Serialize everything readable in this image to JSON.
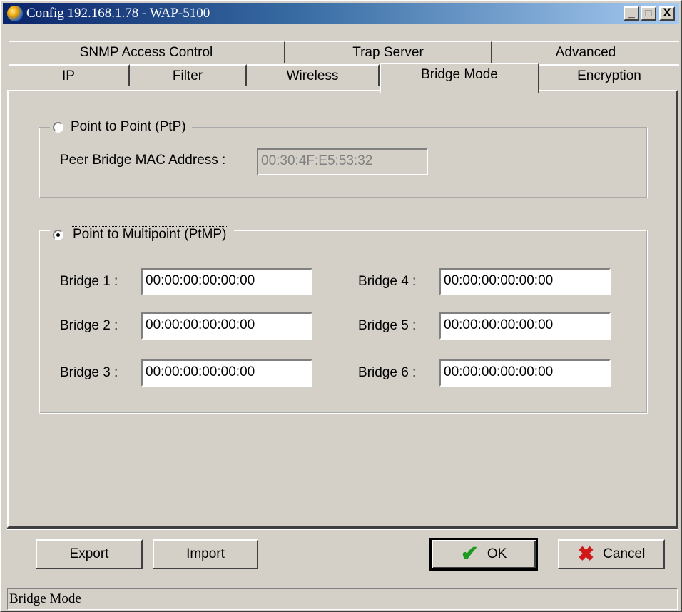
{
  "window": {
    "title": "Config 192.168.1.78 - WAP-5100",
    "controls": {
      "minimize": "_",
      "maximize": "□",
      "close": "X"
    }
  },
  "tabs": {
    "row1": [
      "SNMP Access Control",
      "Trap Server",
      "Advanced"
    ],
    "row2": [
      "IP",
      "Filter",
      "Wireless",
      "Bridge Mode",
      "Encryption"
    ],
    "active": "Bridge Mode"
  },
  "ptp": {
    "radio_label": "Point to Point (PtP)",
    "selected": false,
    "mac_label": "Peer Bridge MAC Address :",
    "mac_value": "00:30:4F:E5:53:32"
  },
  "ptmp": {
    "radio_label": "Point to Multipoint (PtMP)",
    "selected": true,
    "bridges": [
      {
        "label": "Bridge 1 :",
        "value": "00:00:00:00:00:00"
      },
      {
        "label": "Bridge 2 :",
        "value": "00:00:00:00:00:00"
      },
      {
        "label": "Bridge 3 :",
        "value": "00:00:00:00:00:00"
      },
      {
        "label": "Bridge 4 :",
        "value": "00:00:00:00:00:00"
      },
      {
        "label": "Bridge 5 :",
        "value": "00:00:00:00:00:00"
      },
      {
        "label": "Bridge 6 :",
        "value": "00:00:00:00:00:00"
      }
    ]
  },
  "buttons": {
    "export": {
      "prefix": "",
      "key": "E",
      "rest": "xport"
    },
    "import": {
      "prefix": "",
      "key": "I",
      "rest": "mport"
    },
    "ok": "OK",
    "cancel": {
      "prefix": "",
      "key": "C",
      "rest": "ancel"
    }
  },
  "status": {
    "text": "Bridge Mode"
  },
  "colors": {
    "dialog_bg": "#d4d0c8",
    "title_start": "#0a246a",
    "title_end": "#a6caf0",
    "ok_check": "#1e9a1e",
    "cancel_x": "#d01818"
  },
  "icons": {
    "app": "app-globe-icon",
    "ok": "checkmark-icon",
    "cancel": "x-mark-icon"
  }
}
